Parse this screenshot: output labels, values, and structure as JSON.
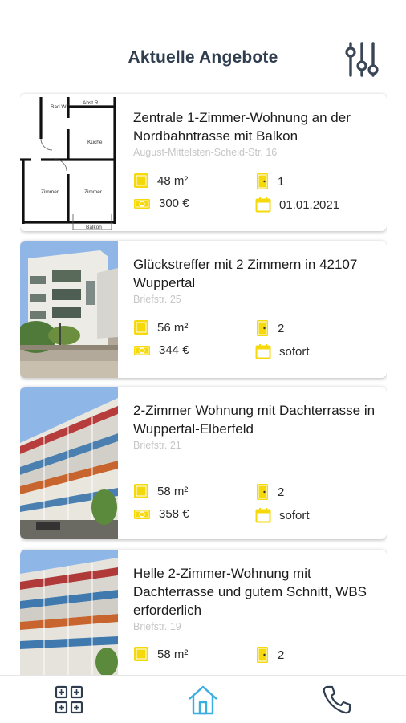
{
  "header": {
    "title": "Aktuelle Angebote",
    "filter_icon": "sliders-icon"
  },
  "listings": [
    {
      "title": "Zentrale 1-Zimmer-Wohnung an der Nordbahntrasse mit Balkon",
      "address": "August-Mittelsten-Scheid-Str. 16",
      "area": "48 m²",
      "rooms": "1",
      "price": "300 €",
      "available": "01.01.2021",
      "image": "floor-plan",
      "plan_labels": [
        "Bad WC",
        "Abst.R.",
        "Küche",
        "Zimmer",
        "Zimmer",
        "Balkon"
      ]
    },
    {
      "title": "Glückstreffer mit 2 Zimmern in 42107 Wuppertal",
      "address": "Briefstr. 25",
      "area": "56 m²",
      "rooms": "2",
      "price": "344 €",
      "available": "sofort",
      "image": "building-photo"
    },
    {
      "title": "2-Zimmer Wohnung mit Dachterrasse in Wuppertal-Elberfeld",
      "address": "Briefstr. 21",
      "area": "58 m²",
      "rooms": "2",
      "price": "358 €",
      "available": "sofort",
      "image": "building-photo"
    },
    {
      "title": "Helle 2-Zimmer-Wohnung mit Dachterrasse und gutem Schnitt, WBS erforderlich",
      "address": "Briefstr. 19",
      "area": "58 m²",
      "rooms": "2",
      "price": "",
      "available": "",
      "image": "building-photo"
    }
  ],
  "icons": {
    "area": "area-icon",
    "rooms": "door-icon",
    "price": "banknote-icon",
    "available": "calendar-icon"
  },
  "nav": [
    {
      "name": "grid-icon"
    },
    {
      "name": "home-icon",
      "active": true
    },
    {
      "name": "phone-icon"
    }
  ],
  "colors": {
    "accent": "#f5d90a",
    "nav_active": "#3aaee0",
    "title": "#2f3d4f",
    "nav_icon": "#2f3d4f"
  }
}
